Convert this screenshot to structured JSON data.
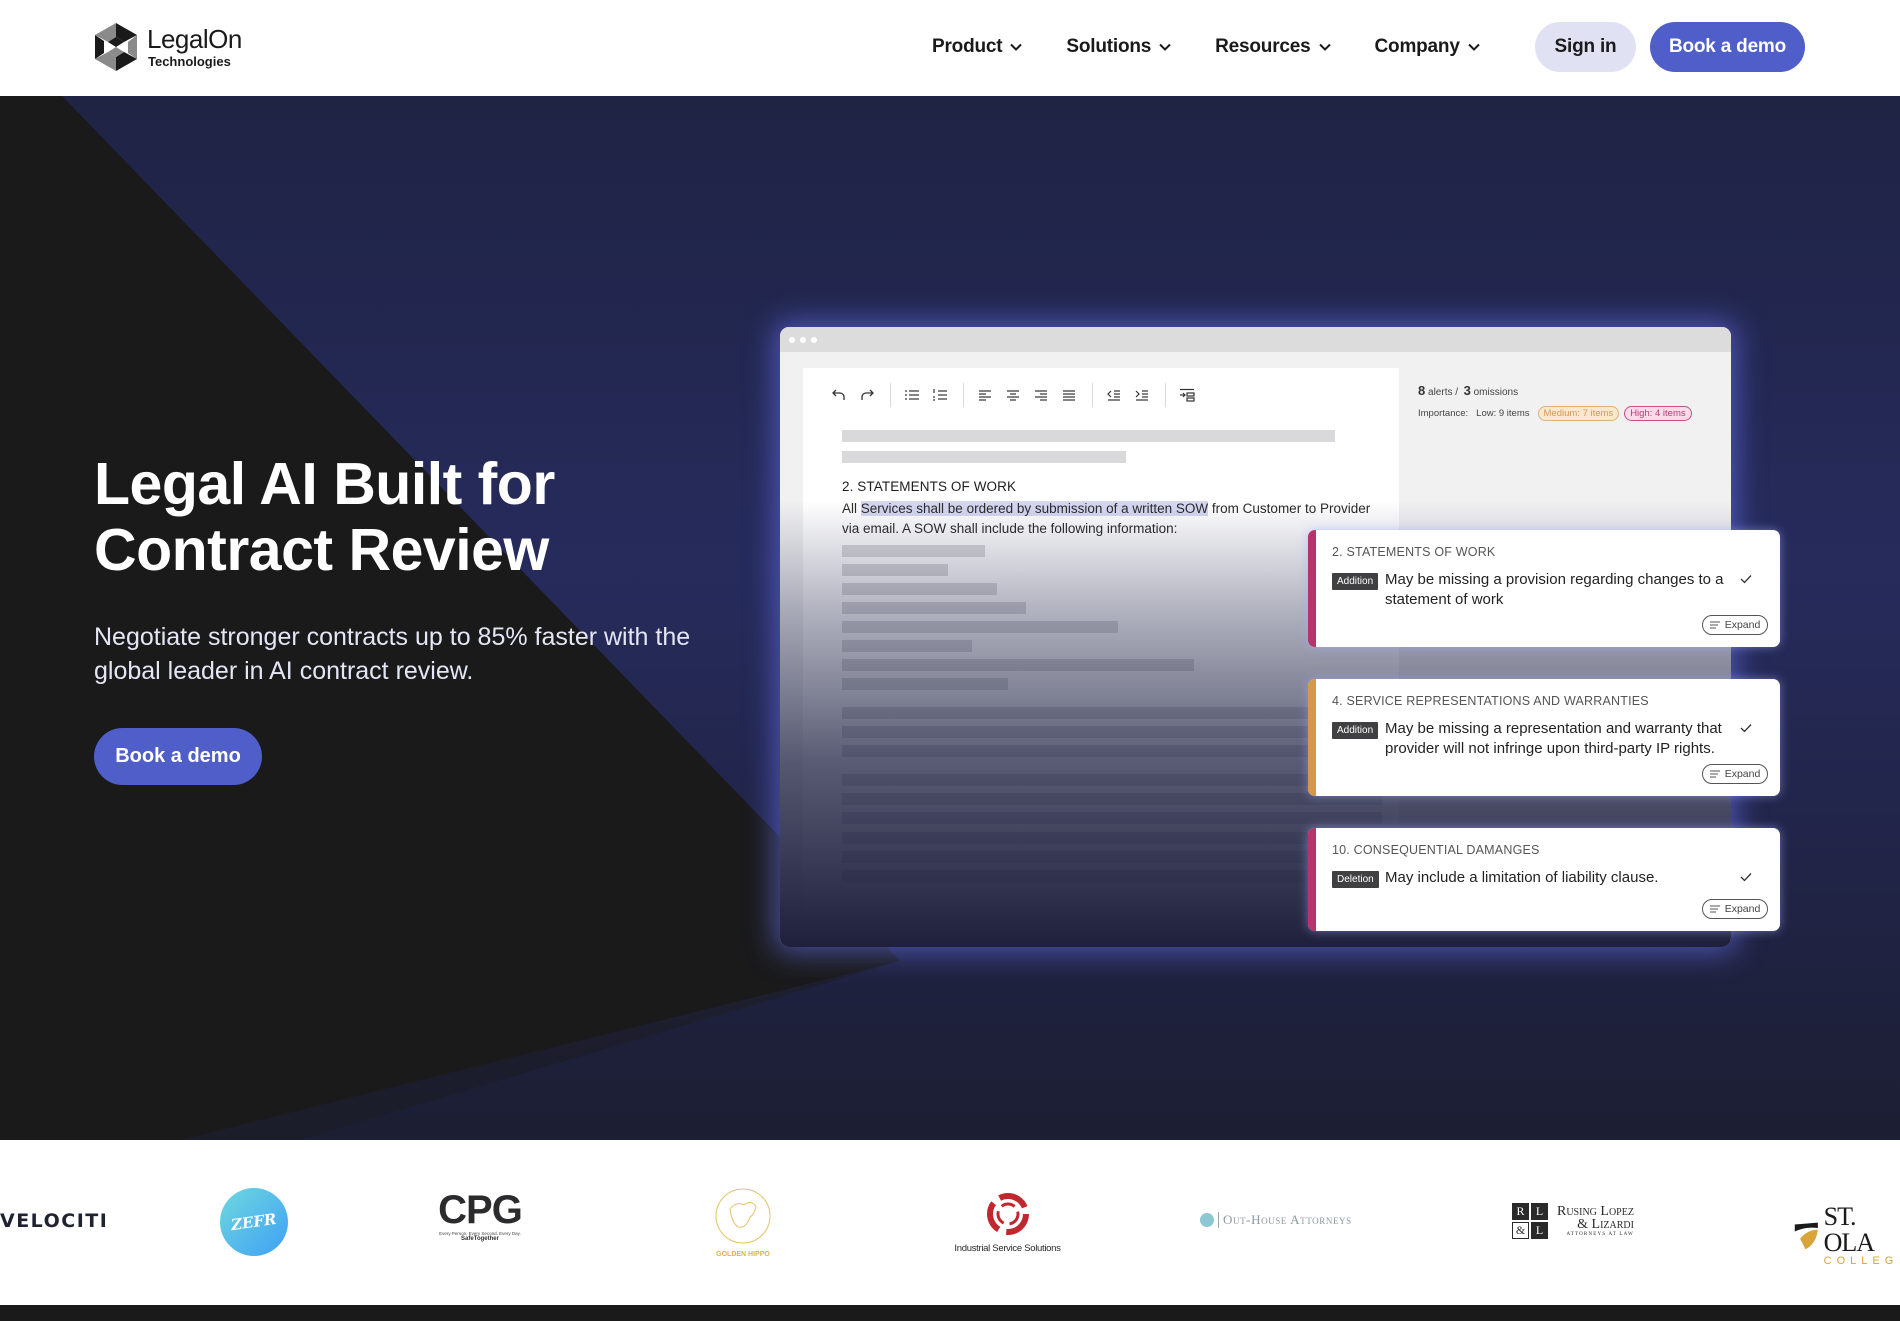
{
  "header": {
    "brand_name": "LegalOn",
    "brand_sub": "Technologies",
    "nav": [
      {
        "label": "Product",
        "icon": "chevron-down-icon"
      },
      {
        "label": "Solutions",
        "icon": "chevron-down-icon"
      },
      {
        "label": "Resources",
        "icon": "chevron-down-icon"
      },
      {
        "label": "Company",
        "icon": "chevron-down-icon"
      }
    ],
    "sign_in_label": "Sign in",
    "book_demo_label": "Book a demo"
  },
  "hero": {
    "title": "Legal AI Built for Contract Review",
    "subtitle": "Negotiate stronger contracts up to 85% faster with the global leader in AI contract review.",
    "cta_label": "Book a demo"
  },
  "editor": {
    "toolbar_icons": [
      "undo-icon",
      "redo-icon",
      "bullet-list-icon",
      "numbered-list-icon",
      "align-left-icon",
      "align-center-icon",
      "align-right-icon",
      "align-justify-icon",
      "outdent-icon",
      "indent-icon",
      "insert-section-icon"
    ],
    "section_heading": "2. STATEMENTS OF WORK",
    "para_before": "All ",
    "para_highlight": "Services shall be ordered by submission of a written SOW",
    "para_after": " from Customer to Provider via email. A SOW shall include the following information:",
    "stats": {
      "alerts_count": "8",
      "alerts_label": "alerts /",
      "omissions_count": "3",
      "omissions_label": "omissions",
      "importance_label": "Importance:",
      "low": "Low: 9 items",
      "medium": "Medium: 7 items",
      "high": "High: 4 items"
    }
  },
  "alerts": [
    {
      "section": "2. STATEMENTS OF WORK",
      "tag": "Addition",
      "text": "May be missing a provision regarding changes to a statement of work",
      "severity_color": "#b8336a",
      "expand_label": "Expand"
    },
    {
      "section": "4. SERVICE REPRESENTATIONS AND WARRANTIES",
      "tag": "Addition",
      "text": "May be missing a representation and warranty that provider will not infringe upon third-party IP rights.",
      "severity_color": "#d6974a",
      "expand_label": "Expand"
    },
    {
      "section": "10. CONSEQUENTIAL DAMANGES",
      "tag": "Deletion",
      "text": "May include a limitation of liability clause.",
      "severity_color": "#b8336a",
      "expand_label": "Expand"
    }
  ],
  "customer_logos": [
    {
      "name": "VELOCITI"
    },
    {
      "name": "ZEFR"
    },
    {
      "name": "CPG",
      "tagline": "Every Person. Every Second. Every Day.",
      "tagline2": "SafeTogether"
    },
    {
      "name": "GOLDEN HIPPO"
    },
    {
      "name": "Industrial Service Solutions"
    },
    {
      "name": "Out-House Attorneys"
    },
    {
      "name": "Rusing Lopez & Lizardi",
      "line1": "Rusing Lopez",
      "line2": "& Lizardi",
      "line3": "ATTORNEYS AT LAW",
      "monogram": [
        "R",
        "L",
        "&",
        "L"
      ]
    },
    {
      "name": "St. Olaf College",
      "line1": "ST. OLA",
      "line2": "COLLEG"
    }
  ],
  "colors": {
    "brand_primary": "#4f5ec8",
    "hero_navy": "#252a5a",
    "hero_dark": "#1a1a1b"
  }
}
